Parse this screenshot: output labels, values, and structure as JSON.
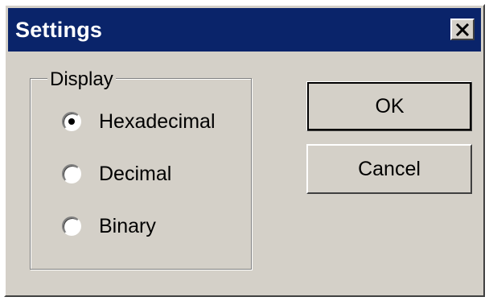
{
  "window": {
    "title": "Settings",
    "close_symbol": "✕"
  },
  "display_group": {
    "legend": "Display",
    "options": [
      {
        "label": "Hexadecimal",
        "selected": true
      },
      {
        "label": "Decimal",
        "selected": false
      },
      {
        "label": "Binary",
        "selected": false
      }
    ]
  },
  "buttons": {
    "ok_label": "OK",
    "cancel_label": "Cancel"
  },
  "colors": {
    "titlebar": "#0a246a",
    "face": "#d4d0c8"
  }
}
